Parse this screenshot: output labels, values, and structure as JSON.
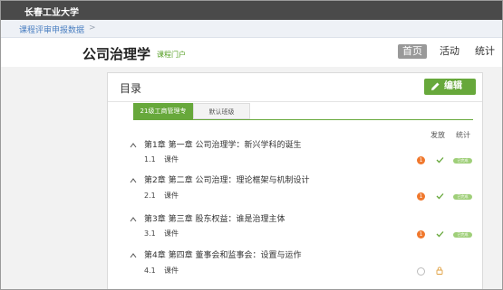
{
  "topbar": {
    "university": "长春工业大学"
  },
  "breadcrumb": {
    "link": "课程评审申报数据",
    "separator": ">"
  },
  "header": {
    "course_title": "公司治理学",
    "course_sub": "课程门户",
    "nav": [
      "首页",
      "活动",
      "统计"
    ]
  },
  "panel": {
    "title": "目录",
    "edit_label": "编辑",
    "tabs": [
      "21级工商管理专",
      "默认班级"
    ],
    "columns": {
      "publish": "发放",
      "stats": "统计"
    },
    "chapters": [
      {
        "title": "第1章 第一章 公司治理学：新兴学科的诞生",
        "item_no": "1.1",
        "item_label": "课件",
        "badge": "1",
        "published": true,
        "pill": "已完成"
      },
      {
        "title": "第2章 第二章 公司治理：理论框架与机制设计",
        "item_no": "2.1",
        "item_label": "课件",
        "badge": "1",
        "published": true,
        "pill": "已完成"
      },
      {
        "title": "第3章 第三章 股东权益：谁是治理主体",
        "item_no": "3.1",
        "item_label": "课件",
        "badge": "1",
        "published": true,
        "pill": "已完成"
      },
      {
        "title": "第4章 第四章 董事会和监事会：设置与运作",
        "item_no": "4.1",
        "item_label": "课件",
        "badge": "",
        "published": false,
        "pill": ""
      }
    ]
  },
  "colors": {
    "accent": "#67a83b",
    "badge": "#f0782d",
    "topbar": "#4a4a4a",
    "link": "#4a7fc1"
  }
}
